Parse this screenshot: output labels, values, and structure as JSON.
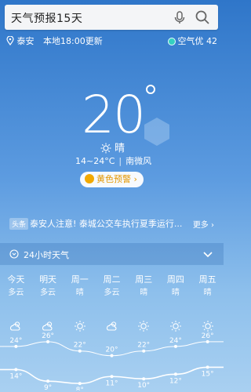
{
  "search": {
    "query": "天气预报15天"
  },
  "location": {
    "city": "泰安",
    "update": "本地18:00更新"
  },
  "air": {
    "label": "空气优 42"
  },
  "current": {
    "temp": "20",
    "condition": "晴",
    "range": "14~24°C",
    "wind": "南微风"
  },
  "alert": {
    "label": "黄色预警"
  },
  "news": {
    "tag": "头条",
    "text": "泰安人注意! 泰城公交车执行夏季运行...",
    "more": "更多"
  },
  "hourly": {
    "label": "24小时天气"
  },
  "forecast": {
    "days": [
      {
        "day": "今天",
        "cond": "多云",
        "icon": "cloud-sun-icon",
        "hi": 24,
        "lo": 14
      },
      {
        "day": "明天",
        "cond": "多云",
        "icon": "cloud-sun-icon",
        "hi": 26,
        "lo": 9
      },
      {
        "day": "周一",
        "cond": "晴",
        "icon": "sun-icon",
        "hi": 22,
        "lo": 8
      },
      {
        "day": "周二",
        "cond": "多云",
        "icon": "cloud-sun-icon",
        "hi": 20,
        "lo": 11
      },
      {
        "day": "周三",
        "cond": "晴",
        "icon": "sun-icon",
        "hi": 22,
        "lo": 10
      },
      {
        "day": "周四",
        "cond": "晴",
        "icon": "sun-icon",
        "hi": 24,
        "lo": 12
      },
      {
        "day": "周五",
        "cond": "晴",
        "icon": "sun-icon",
        "hi": 26,
        "lo": 15
      }
    ]
  },
  "colors": {
    "alert": "#e39700",
    "air_dot": "#35d0c0"
  }
}
